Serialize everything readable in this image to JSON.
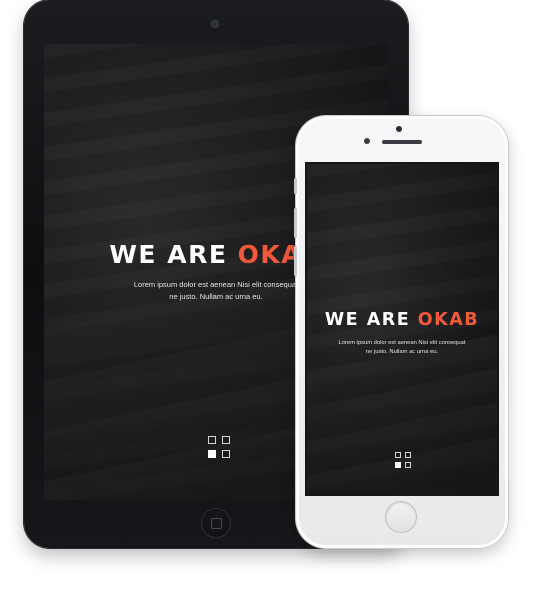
{
  "hero": {
    "title_main": "WE ARE ",
    "title_accent": "OKAB",
    "subtitle_line1": "Lorem ipsum dolor est aenean Nisi elit consequat",
    "subtitle_line2": "ne justo. Nullam ac urna eu."
  },
  "slider": {
    "dots": [
      "slide-1",
      "slide-2",
      "slide-3",
      "slide-4"
    ],
    "active_index": 2
  },
  "colors": {
    "accent": "#f05a3a",
    "text": "#ffffff",
    "tablet_frame": "#0d0e10",
    "phone_frame": "#e8e9eb"
  },
  "icons": {
    "tablet_home": "home-button-icon",
    "phone_home": "home-button-icon",
    "camera": "camera-icon",
    "speaker": "speaker-icon"
  }
}
